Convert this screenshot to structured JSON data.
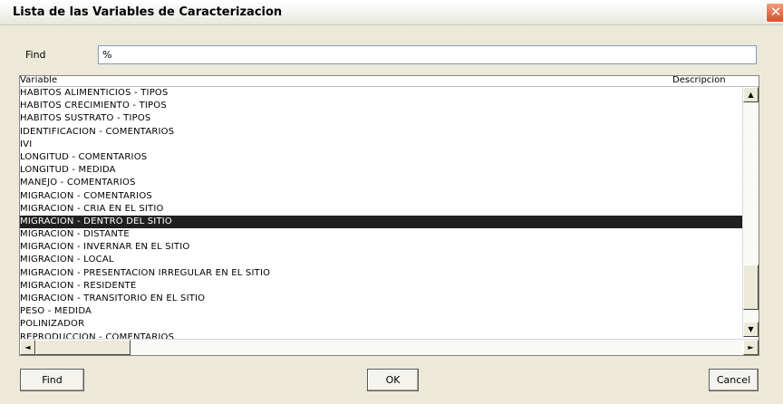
{
  "window": {
    "title": "Lista de las Variables de Caracterizacion",
    "close_glyph": "✕"
  },
  "search": {
    "label": "Find",
    "value": "%"
  },
  "list": {
    "headers": {
      "variable": "Variable",
      "descripcion": "Descripcion"
    },
    "rows": [
      "HABITOS ALIMENTICIOS - TIPOS",
      "HABITOS CRECIMIENTO - TIPOS",
      "HABITOS SUSTRATO - TIPOS",
      "IDENTIFICACION - COMENTARIOS",
      "IVI",
      "LONGITUD - COMENTARIOS",
      "LONGITUD - MEDIDA",
      "MANEJO - COMENTARIOS",
      "MIGRACION - COMENTARIOS",
      "MIGRACION - CRIA EN EL SITIO",
      "MIGRACION - DENTRO DEL SITIO",
      "MIGRACION - DISTANTE",
      "MIGRACION - INVERNAR EN EL SITIO",
      "MIGRACION - LOCAL",
      "MIGRACION - PRESENTACION IRREGULAR EN EL SITIO",
      "MIGRACION - RESIDENTE",
      "MIGRACION - TRANSITORIO EN EL SITIO",
      "PESO - MEDIDA",
      "POLINIZADOR",
      "REPRODUCCION - COMENTARIOS"
    ],
    "selected_index": 10
  },
  "scrollbar": {
    "up": "▲",
    "down": "▼",
    "left": "◄",
    "right": "►"
  },
  "buttons": {
    "find": "Find",
    "ok": "OK",
    "cancel": "Cancel"
  }
}
